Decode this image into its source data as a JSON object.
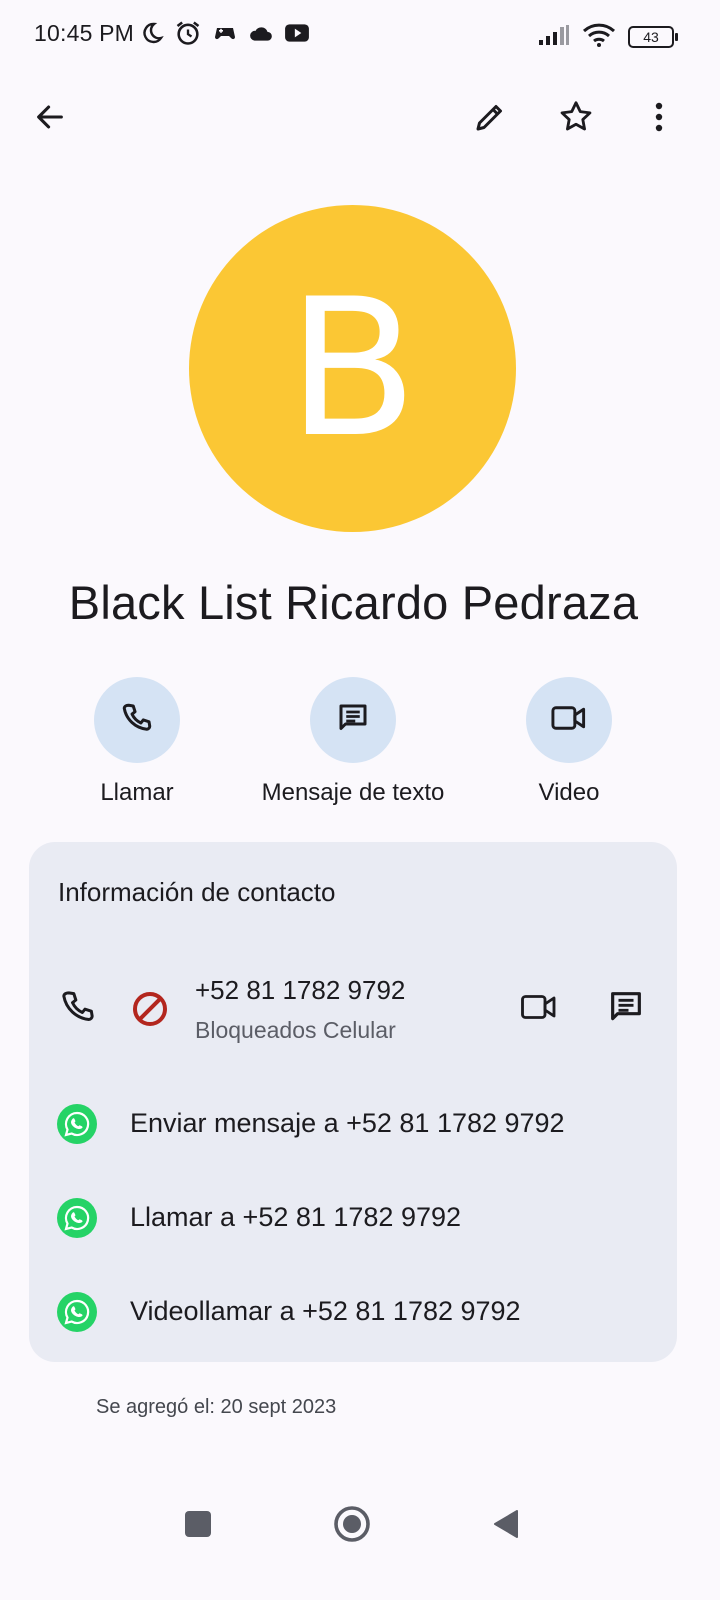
{
  "status_bar": {
    "time": "10:45 PM",
    "left_icons": [
      "moon-icon",
      "alarm-icon",
      "game-controller-icon",
      "cloud-icon",
      "youtube-icon"
    ],
    "right_icons": [
      "signal-icon",
      "wifi-icon"
    ],
    "battery": "43"
  },
  "toolbar": {
    "back_icon": "arrow-back-icon",
    "edit_icon": "pencil-icon",
    "star_icon": "star-outline-icon",
    "more_icon": "more-vert-icon"
  },
  "contact": {
    "initial": "B",
    "avatar_color": "#fbc734",
    "name": "Black List Ricardo Pedraza"
  },
  "actions": [
    {
      "label": "Llamar",
      "icon": "phone-icon"
    },
    {
      "label": "Mensaje de texto",
      "icon": "message-icon"
    },
    {
      "label": "Video",
      "icon": "videocam-icon"
    }
  ],
  "info": {
    "title": "Información de contacto",
    "phone": {
      "number": "+52 81 1782 9792",
      "type": "Bloqueados Celular",
      "blocked_color": "#b3261e"
    },
    "whatsapp": [
      {
        "label": "Enviar mensaje a +52 81 1782 9792"
      },
      {
        "label": "Llamar a +52 81 1782 9792"
      },
      {
        "label": "Videollamar a +52 81 1782 9792"
      }
    ],
    "whatsapp_color": "#25d366"
  },
  "added": "Se agregó el: 20 sept 2023",
  "nav": {
    "recents_icon": "square-icon",
    "home_icon": "circle-home-icon",
    "back_icon": "triangle-back-icon"
  }
}
